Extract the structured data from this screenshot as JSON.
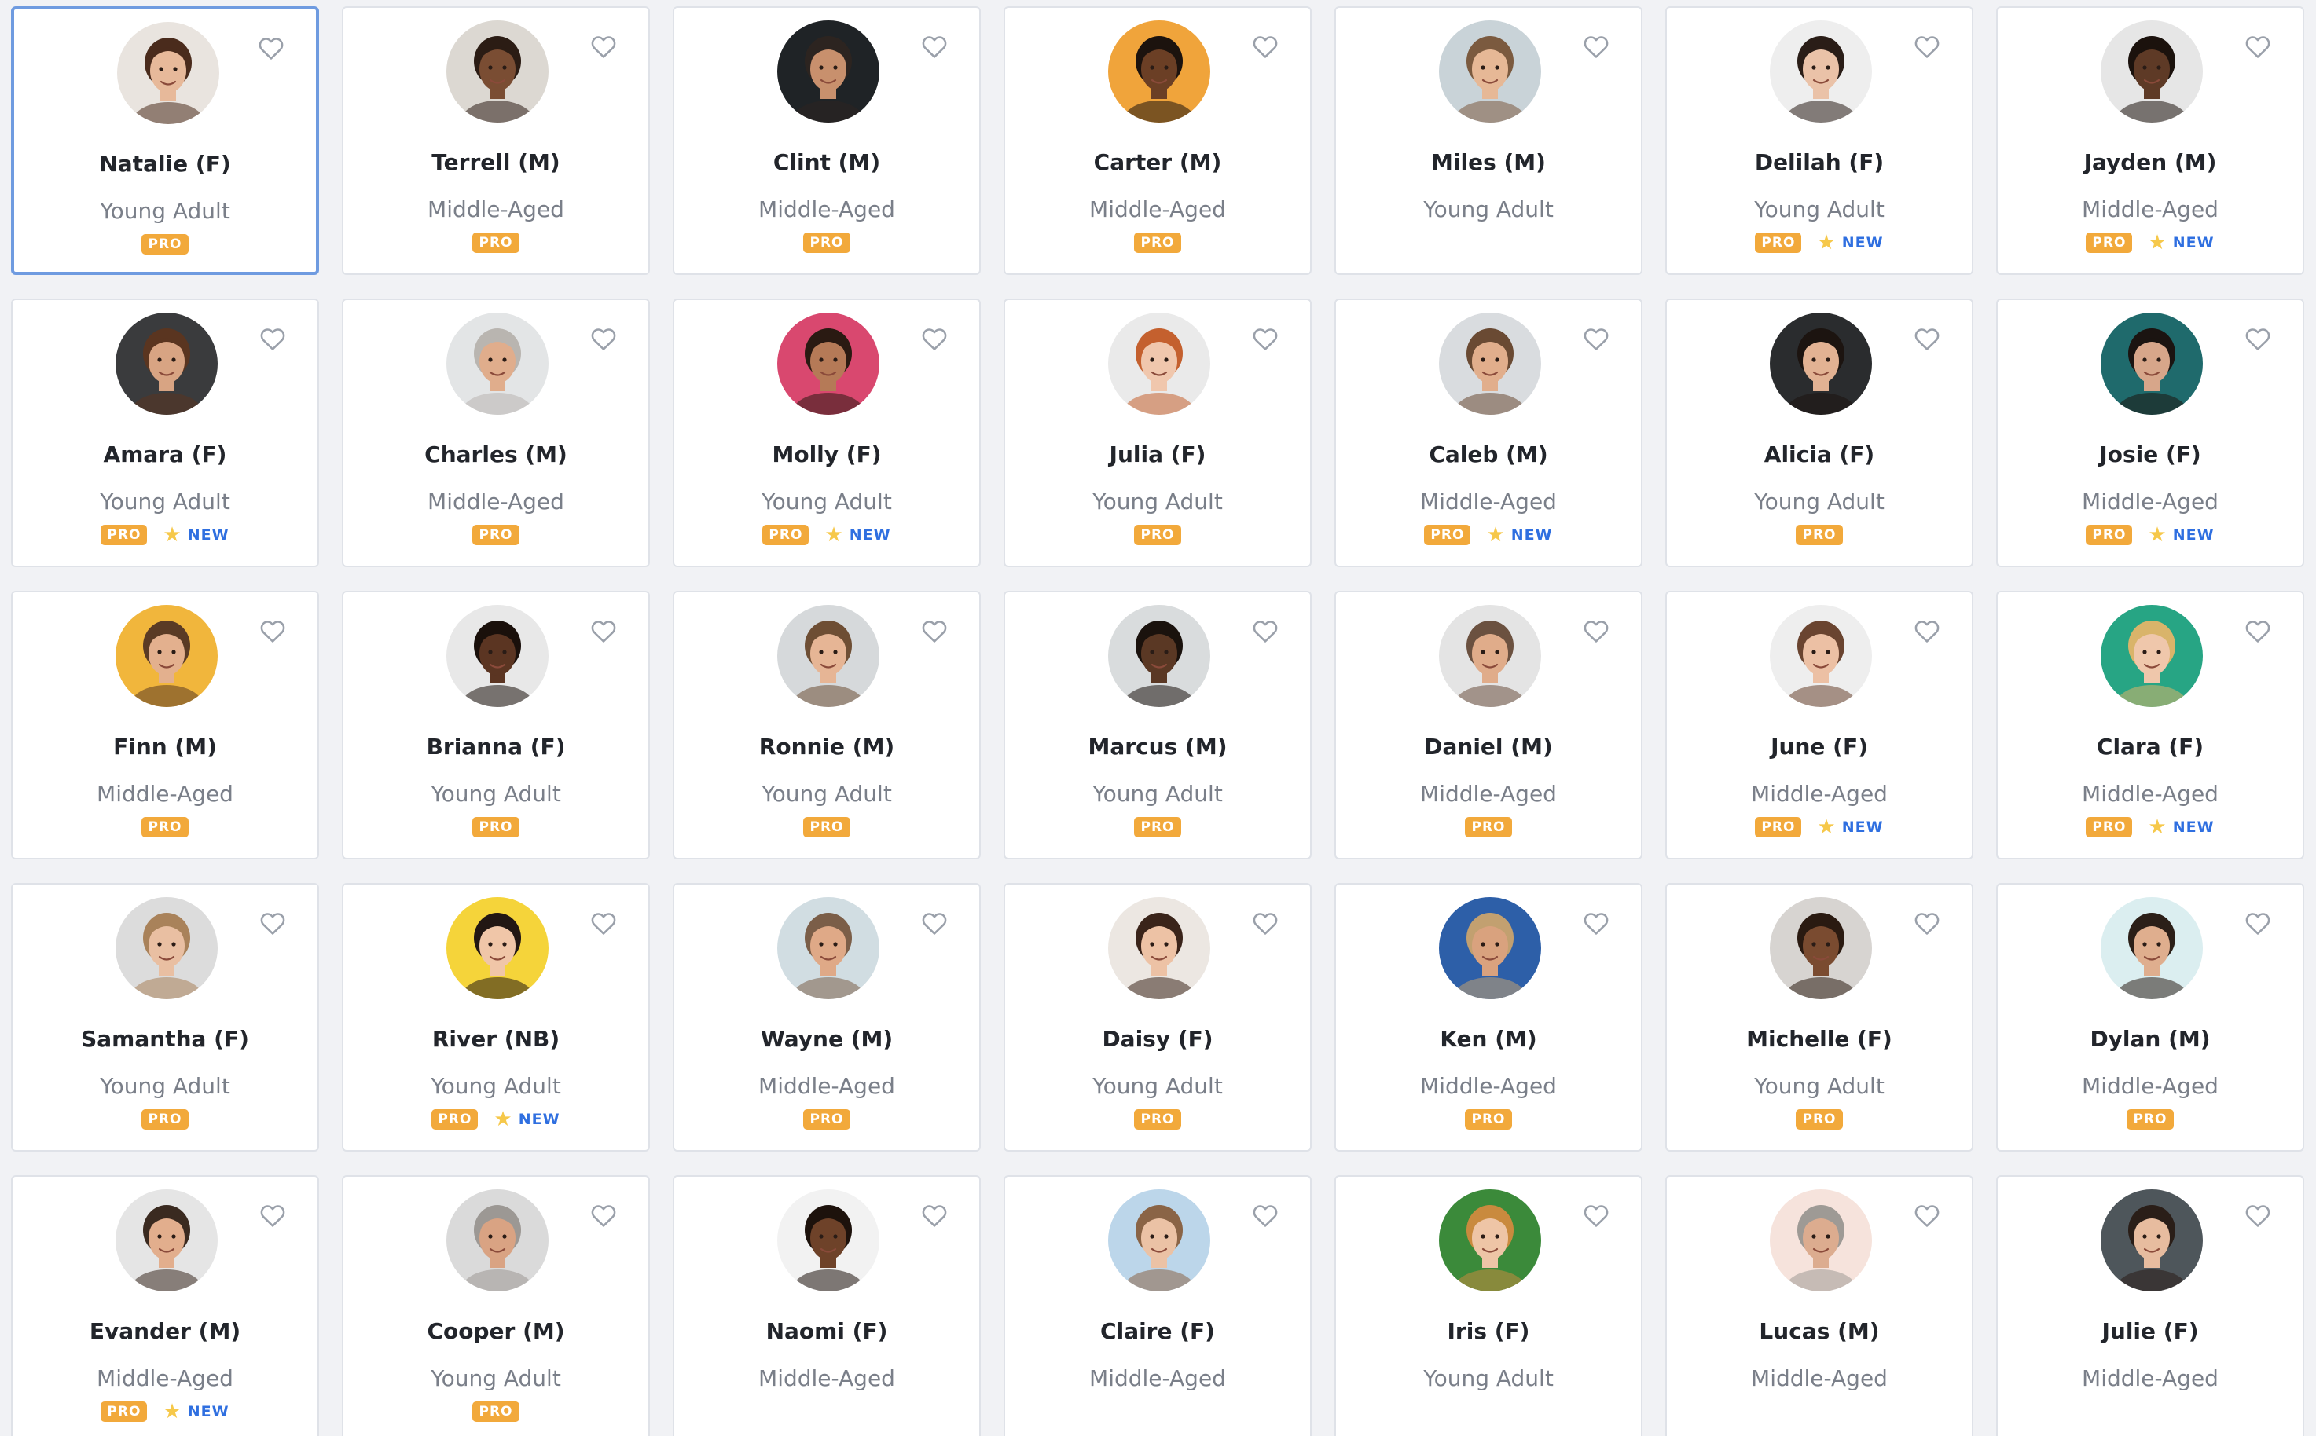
{
  "colors": {
    "background": "#f1f2f5",
    "card_border": "#dfe2e8",
    "selected_border": "#6f9be0",
    "pro_badge": "#f2a93b",
    "new_badge": "#2f6fe0",
    "star": "#f6c84a"
  },
  "icons": {
    "favorite": "heart-outline-icon",
    "new": "star-icon"
  },
  "badge_labels": {
    "pro": "PRO",
    "new": "NEW"
  },
  "avatars": [
    {
      "name": "Natalie (F)",
      "age": "Young Adult",
      "pro": true,
      "new": false,
      "selected": true,
      "bg": "#e9e4df",
      "skin": "#e7b99a",
      "hair": "#4a2b1c"
    },
    {
      "name": "Terrell (M)",
      "age": "Middle-Aged",
      "pro": true,
      "new": false,
      "bg": "#dcd8d2",
      "skin": "#7a4d33",
      "hair": "#2b1c14"
    },
    {
      "name": "Clint (M)",
      "age": "Middle-Aged",
      "pro": true,
      "new": false,
      "bg": "#1f2326",
      "skin": "#c8906d",
      "hair": "#2c2420"
    },
    {
      "name": "Carter (M)",
      "age": "Middle-Aged",
      "pro": true,
      "new": false,
      "bg": "#f0a43b",
      "skin": "#6b3f25",
      "hair": "#1c130e"
    },
    {
      "name": "Miles (M)",
      "age": "Young Adult",
      "pro": false,
      "new": false,
      "bg": "#c9d3d8",
      "skin": "#e6b896",
      "hair": "#7b5a3f"
    },
    {
      "name": "Delilah (F)",
      "age": "Young Adult",
      "pro": true,
      "new": true,
      "bg": "#eeeeee",
      "skin": "#eac2a8",
      "hair": "#2a1d17"
    },
    {
      "name": "Jayden (M)",
      "age": "Middle-Aged",
      "pro": true,
      "new": true,
      "bg": "#e6e6e6",
      "skin": "#5e3a26",
      "hair": "#1b120d"
    },
    {
      "name": "Amara (F)",
      "age": "Young Adult",
      "pro": true,
      "new": true,
      "bg": "#3a3b3d",
      "skin": "#d8a483",
      "hair": "#5a3520"
    },
    {
      "name": "Charles (M)",
      "age": "Middle-Aged",
      "pro": true,
      "new": false,
      "bg": "#e3e5e6",
      "skin": "#e0ad8c",
      "hair": "#b9b5b0"
    },
    {
      "name": "Molly (F)",
      "age": "Young Adult",
      "pro": true,
      "new": true,
      "bg": "#d9486f",
      "skin": "#b57a57",
      "hair": "#2a1a12"
    },
    {
      "name": "Julia (F)",
      "age": "Young Adult",
      "pro": true,
      "new": false,
      "bg": "#eaeaea",
      "skin": "#f0c7ad",
      "hair": "#c4602e"
    },
    {
      "name": "Caleb (M)",
      "age": "Middle-Aged",
      "pro": true,
      "new": true,
      "bg": "#d9dcdf",
      "skin": "#e1ae8c",
      "hair": "#6a4a33"
    },
    {
      "name": "Alicia (F)",
      "age": "Young Adult",
      "pro": true,
      "new": false,
      "bg": "#2a2c2e",
      "skin": "#e2b293",
      "hair": "#1c1410"
    },
    {
      "name": "Josie (F)",
      "age": "Middle-Aged",
      "pro": true,
      "new": true,
      "bg": "#1f6a6c",
      "skin": "#d7a68a",
      "hair": "#1b1411"
    },
    {
      "name": "Finn (M)",
      "age": "Middle-Aged",
      "pro": true,
      "new": false,
      "bg": "#f1b63c",
      "skin": "#e3b08e",
      "hair": "#5a3b25"
    },
    {
      "name": "Brianna (F)",
      "age": "Young Adult",
      "pro": true,
      "new": false,
      "bg": "#e8e8e8",
      "skin": "#5b3522",
      "hair": "#1a100b"
    },
    {
      "name": "Ronnie (M)",
      "age": "Young Adult",
      "pro": true,
      "new": false,
      "bg": "#d6d9db",
      "skin": "#e6b595",
      "hair": "#6e4e34"
    },
    {
      "name": "Marcus (M)",
      "age": "Young Adult",
      "pro": true,
      "new": false,
      "bg": "#d9dcdd",
      "skin": "#5a3824",
      "hair": "#1a120d"
    },
    {
      "name": "Daniel (M)",
      "age": "Middle-Aged",
      "pro": true,
      "new": false,
      "bg": "#e4e4e4",
      "skin": "#e0ac8a",
      "hair": "#6b5140"
    },
    {
      "name": "June (F)",
      "age": "Middle-Aged",
      "pro": true,
      "new": true,
      "bg": "#eeeeee",
      "skin": "#ecc0a4",
      "hair": "#6a4430"
    },
    {
      "name": "Clara (F)",
      "age": "Middle-Aged",
      "pro": true,
      "new": true,
      "bg": "#27a584",
      "skin": "#efc7ab",
      "hair": "#d9b46a"
    },
    {
      "name": "Samantha (F)",
      "age": "Young Adult",
      "pro": true,
      "new": false,
      "bg": "#dcdcdc",
      "skin": "#e9bfa2",
      "hair": "#a9825a"
    },
    {
      "name": "River (NB)",
      "age": "Young Adult",
      "pro": true,
      "new": true,
      "bg": "#f5d43a",
      "skin": "#f0c6a8",
      "hair": "#221713"
    },
    {
      "name": "Wayne (M)",
      "age": "Middle-Aged",
      "pro": true,
      "new": false,
      "bg": "#d1dde2",
      "skin": "#dfa987",
      "hair": "#7b5e48"
    },
    {
      "name": "Daisy (F)",
      "age": "Young Adult",
      "pro": true,
      "new": false,
      "bg": "#ece7e2",
      "skin": "#edc2a5",
      "hair": "#3a241a"
    },
    {
      "name": "Ken (M)",
      "age": "Middle-Aged",
      "pro": true,
      "new": false,
      "bg": "#2d5fa8",
      "skin": "#d9a27e",
      "hair": "#c2a070"
    },
    {
      "name": "Michelle (F)",
      "age": "Young Adult",
      "pro": true,
      "new": false,
      "bg": "#d7d4d1",
      "skin": "#7a4b30",
      "hair": "#2a1a11"
    },
    {
      "name": "Dylan (M)",
      "age": "Middle-Aged",
      "pro": true,
      "new": false,
      "bg": "#dbeef0",
      "skin": "#dfae8e",
      "hair": "#2b1f18"
    },
    {
      "name": "Evander (M)",
      "age": "Middle-Aged",
      "pro": true,
      "new": true,
      "bg": "#e5e5e5",
      "skin": "#e2ae8d",
      "hair": "#3a2a20"
    },
    {
      "name": "Cooper (M)",
      "age": "Young Adult",
      "pro": true,
      "new": false,
      "bg": "#dadada",
      "skin": "#d9a383",
      "hair": "#9c9894"
    },
    {
      "name": "Naomi (F)",
      "age": "Middle-Aged",
      "pro": false,
      "new": false,
      "bg": "#f2f2f2",
      "skin": "#6e4229",
      "hair": "#1d120c"
    },
    {
      "name": "Claire (F)",
      "age": "Middle-Aged",
      "pro": false,
      "new": false,
      "bg": "#bcd6ea",
      "skin": "#ebc2a5",
      "hair": "#8a6446"
    },
    {
      "name": "Iris (F)",
      "age": "Young Adult",
      "pro": false,
      "new": false,
      "bg": "#3b8a3a",
      "skin": "#eec5a6",
      "hair": "#c98a3e"
    },
    {
      "name": "Lucas (M)",
      "age": "Middle-Aged",
      "pro": false,
      "new": false,
      "bg": "#f6e3dc",
      "skin": "#dcac8f",
      "hair": "#9e9a95"
    },
    {
      "name": "Julie (F)",
      "age": "Middle-Aged",
      "pro": false,
      "new": false,
      "bg": "#4e565b",
      "skin": "#e7bc9f",
      "hair": "#2a1e18"
    }
  ]
}
